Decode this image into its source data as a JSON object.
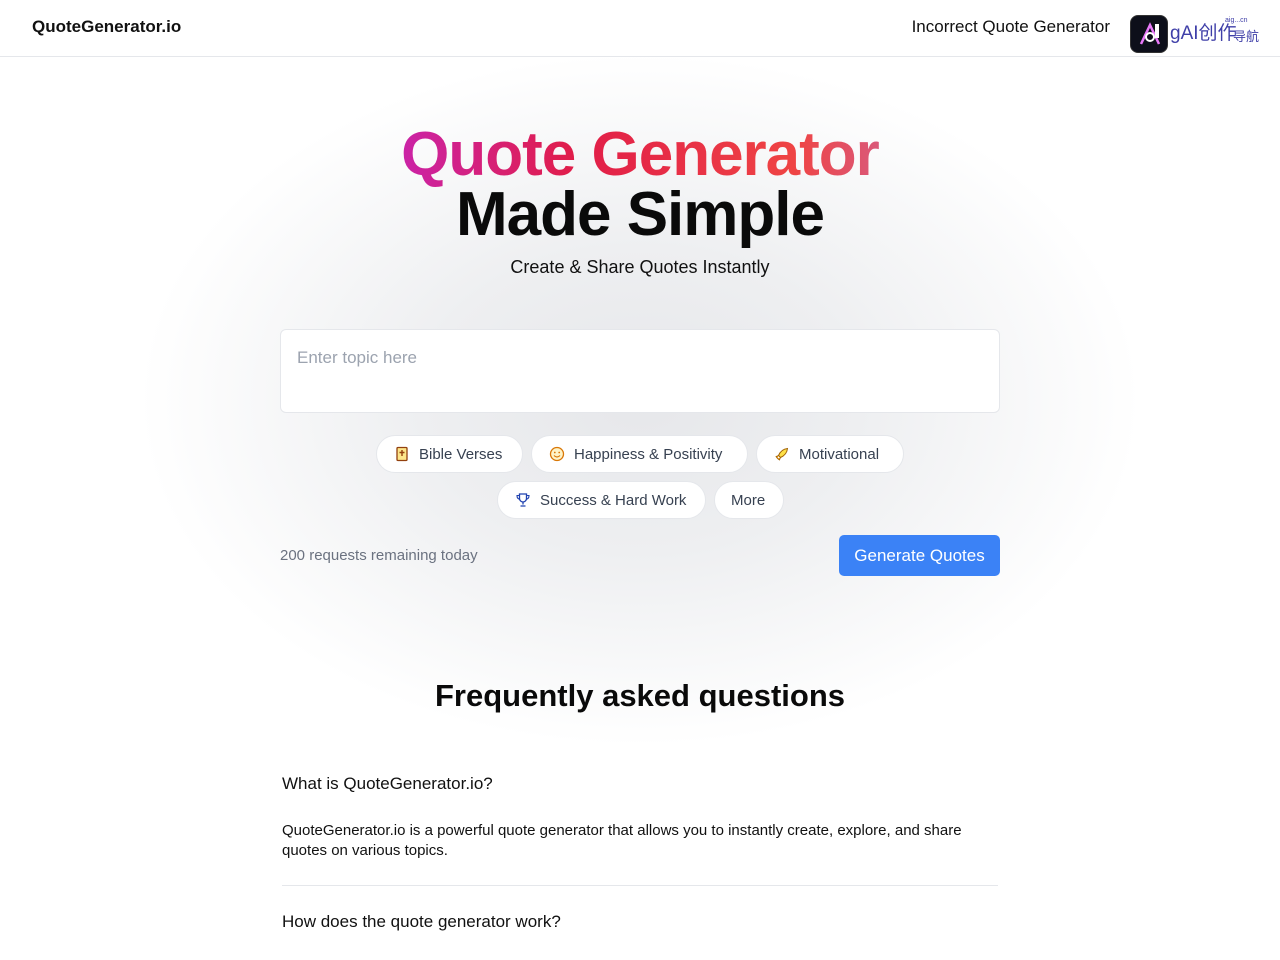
{
  "header": {
    "brand": "QuoteGenerator.io",
    "nav_link": "Incorrect Quote Generator",
    "badge_text": "AI创作",
    "badge_sub": "aig...cn",
    "badge_sub2": "导航",
    "badge_fragment": "g"
  },
  "hero": {
    "title_line1": "Quote Generator",
    "title_line2": "Made Simple",
    "subtitle": "Create & Share Quotes Instantly"
  },
  "topic_input": {
    "placeholder": "Enter topic here",
    "value": ""
  },
  "chips": [
    {
      "label": "Bible Verses",
      "icon": "book-icon"
    },
    {
      "label": "Happiness & Positivity",
      "icon": "smile-icon"
    },
    {
      "label": "Motivational",
      "icon": "rocket-icon"
    },
    {
      "label": "Success & Hard Work",
      "icon": "trophy-icon"
    },
    {
      "label": "More",
      "icon": ""
    }
  ],
  "requests_remaining": "200 requests remaining today",
  "generate_label": "Generate Quotes",
  "faq": {
    "title": "Frequently asked questions",
    "items": [
      {
        "question": "What is QuoteGenerator.io?",
        "answer": "QuoteGenerator.io is a powerful quote generator that allows you to instantly create, explore, and share quotes on various topics."
      },
      {
        "question": "How does the quote generator work?",
        "answer": ""
      }
    ]
  },
  "colors": {
    "accent": "#3b82f6",
    "gradient": [
      "#9333ea",
      "#e11d48",
      "#818cf8"
    ],
    "border": "#e5e7eb"
  }
}
